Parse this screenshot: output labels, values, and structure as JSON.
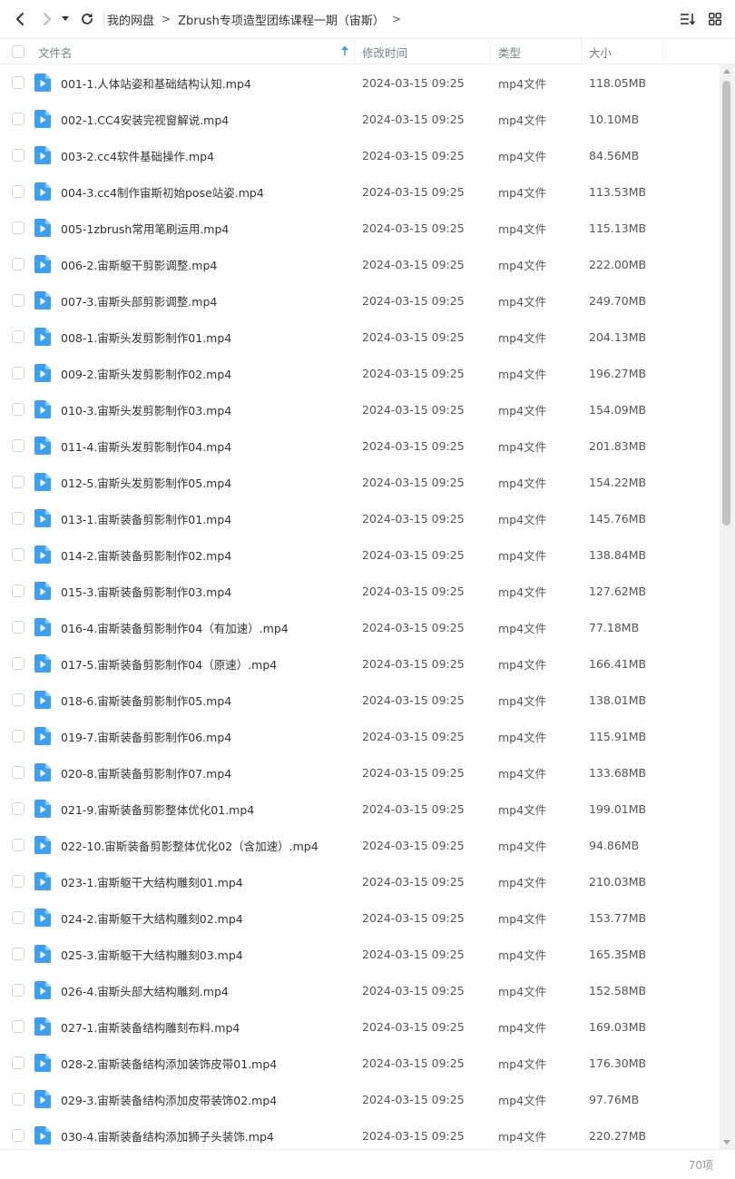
{
  "breadcrumb": {
    "items": [
      "我的网盘",
      "Zbrush专项造型团练课程一期（宙斯）"
    ],
    "separator": ">"
  },
  "columns": {
    "name": "文件名",
    "modified": "修改时间",
    "type": "类型",
    "size": "大小"
  },
  "icons": {
    "back": "arrow-left-icon",
    "forward": "arrow-right-icon",
    "history": "caret-down-icon",
    "refresh": "refresh-icon",
    "sort": "sort-list-icon",
    "grid": "grid-view-icon",
    "file": "video-file-icon"
  },
  "colors": {
    "accent": "#3a9ff5",
    "file_icon": "#3a9ff5"
  },
  "files": [
    {
      "name": "001-1.人体站姿和基础结构认知.mp4",
      "modified": "2024-03-15 09:25",
      "type": "mp4文件",
      "size": "118.05MB"
    },
    {
      "name": "002-1.CC4安装完视窗解说.mp4",
      "modified": "2024-03-15 09:25",
      "type": "mp4文件",
      "size": "10.10MB"
    },
    {
      "name": "003-2.cc4软件基础操作.mp4",
      "modified": "2024-03-15 09:25",
      "type": "mp4文件",
      "size": "84.56MB"
    },
    {
      "name": "004-3.cc4制作宙斯初始pose站姿.mp4",
      "modified": "2024-03-15 09:25",
      "type": "mp4文件",
      "size": "113.53MB"
    },
    {
      "name": "005-1zbrush常用笔刷运用.mp4",
      "modified": "2024-03-15 09:25",
      "type": "mp4文件",
      "size": "115.13MB"
    },
    {
      "name": "006-2.宙斯躯干剪影调整.mp4",
      "modified": "2024-03-15 09:25",
      "type": "mp4文件",
      "size": "222.00MB"
    },
    {
      "name": "007-3.宙斯头部剪影调整.mp4",
      "modified": "2024-03-15 09:25",
      "type": "mp4文件",
      "size": "249.70MB"
    },
    {
      "name": "008-1.宙斯头发剪影制作01.mp4",
      "modified": "2024-03-15 09:25",
      "type": "mp4文件",
      "size": "204.13MB"
    },
    {
      "name": "009-2.宙斯头发剪影制作02.mp4",
      "modified": "2024-03-15 09:25",
      "type": "mp4文件",
      "size": "196.27MB"
    },
    {
      "name": "010-3.宙斯头发剪影制作03.mp4",
      "modified": "2024-03-15 09:25",
      "type": "mp4文件",
      "size": "154.09MB"
    },
    {
      "name": "011-4.宙斯头发剪影制作04.mp4",
      "modified": "2024-03-15 09:25",
      "type": "mp4文件",
      "size": "201.83MB"
    },
    {
      "name": "012-5.宙斯头发剪影制作05.mp4",
      "modified": "2024-03-15 09:25",
      "type": "mp4文件",
      "size": "154.22MB"
    },
    {
      "name": "013-1.宙斯装备剪影制作01.mp4",
      "modified": "2024-03-15 09:25",
      "type": "mp4文件",
      "size": "145.76MB"
    },
    {
      "name": "014-2.宙斯装备剪影制作02.mp4",
      "modified": "2024-03-15 09:25",
      "type": "mp4文件",
      "size": "138.84MB"
    },
    {
      "name": "015-3.宙斯装备剪影制作03.mp4",
      "modified": "2024-03-15 09:25",
      "type": "mp4文件",
      "size": "127.62MB"
    },
    {
      "name": "016-4.宙斯装备剪影制作04（有加速）.mp4",
      "modified": "2024-03-15 09:25",
      "type": "mp4文件",
      "size": "77.18MB"
    },
    {
      "name": "017-5.宙斯装备剪影制作04（原速）.mp4",
      "modified": "2024-03-15 09:25",
      "type": "mp4文件",
      "size": "166.41MB"
    },
    {
      "name": "018-6.宙斯装备剪影制作05.mp4",
      "modified": "2024-03-15 09:25",
      "type": "mp4文件",
      "size": "138.01MB"
    },
    {
      "name": "019-7.宙斯装备剪影制作06.mp4",
      "modified": "2024-03-15 09:25",
      "type": "mp4文件",
      "size": "115.91MB"
    },
    {
      "name": "020-8.宙斯装备剪影制作07.mp4",
      "modified": "2024-03-15 09:25",
      "type": "mp4文件",
      "size": "133.68MB"
    },
    {
      "name": "021-9.宙斯装备剪影整体优化01.mp4",
      "modified": "2024-03-15 09:25",
      "type": "mp4文件",
      "size": "199.01MB"
    },
    {
      "name": "022-10.宙斯装备剪影整体优化02（含加速）.mp4",
      "modified": "2024-03-15 09:25",
      "type": "mp4文件",
      "size": "94.86MB"
    },
    {
      "name": "023-1.宙斯躯干大结构雕刻01.mp4",
      "modified": "2024-03-15 09:25",
      "type": "mp4文件",
      "size": "210.03MB"
    },
    {
      "name": "024-2.宙斯躯干大结构雕刻02.mp4",
      "modified": "2024-03-15 09:25",
      "type": "mp4文件",
      "size": "153.77MB"
    },
    {
      "name": "025-3.宙斯躯干大结构雕刻03.mp4",
      "modified": "2024-03-15 09:25",
      "type": "mp4文件",
      "size": "165.35MB"
    },
    {
      "name": "026-4.宙斯头部大结构雕刻.mp4",
      "modified": "2024-03-15 09:25",
      "type": "mp4文件",
      "size": "152.58MB"
    },
    {
      "name": "027-1.宙斯装备结构雕刻布料.mp4",
      "modified": "2024-03-15 09:25",
      "type": "mp4文件",
      "size": "169.03MB"
    },
    {
      "name": "028-2.宙斯装备结构添加装饰皮带01.mp4",
      "modified": "2024-03-15 09:25",
      "type": "mp4文件",
      "size": "176.30MB"
    },
    {
      "name": "029-3.宙斯装备结构添加皮带装饰02.mp4",
      "modified": "2024-03-15 09:25",
      "type": "mp4文件",
      "size": "97.76MB"
    },
    {
      "name": "030-4.宙斯装备结构添加狮子头装饰.mp4",
      "modified": "2024-03-15 09:25",
      "type": "mp4文件",
      "size": "220.27MB"
    }
  ],
  "footer": {
    "count": "70项"
  }
}
